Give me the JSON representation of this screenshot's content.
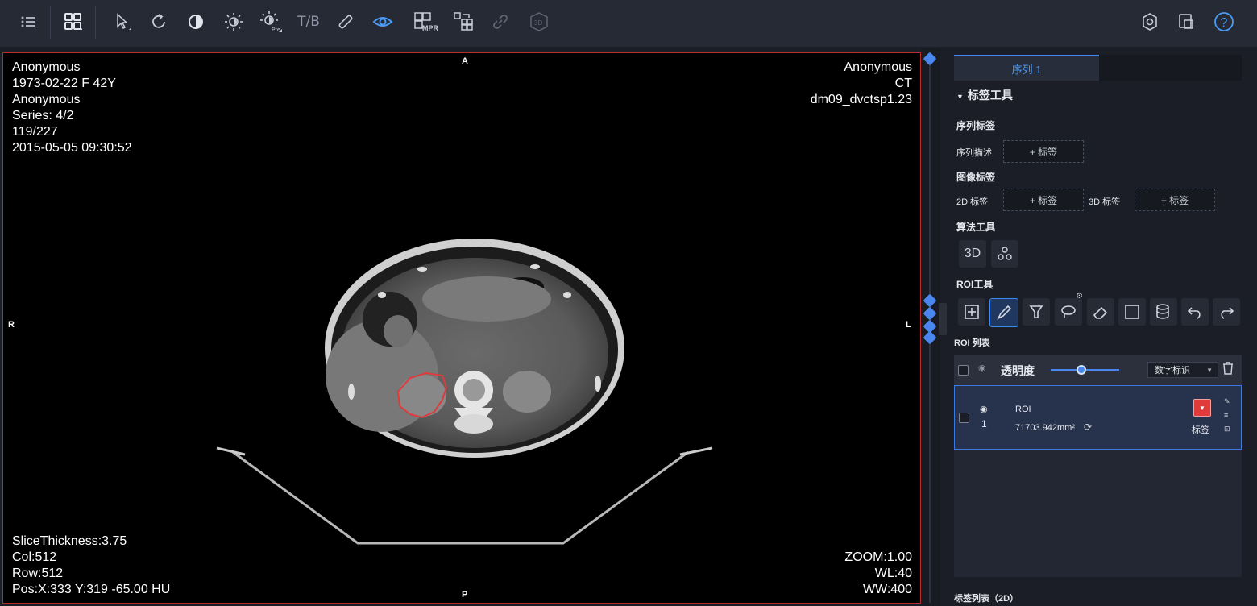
{
  "toolbar": {
    "icons": [
      "list-icon",
      "layout-grid-icon",
      "pointer-icon",
      "rotate-icon",
      "invert-icon",
      "brightness-icon",
      "brightness-preset-icon",
      "tb-toggle",
      "measure-ruler-icon",
      "eye-icon",
      "mpr-icon",
      "grid-swap-icon",
      "link-icon",
      "3d-icon",
      "settings-icon",
      "export-icon",
      "help-icon"
    ],
    "tb_label": "T/B",
    "mpr_label": "MPR",
    "badge_3d": "3D",
    "pre_label": "Pre"
  },
  "viewer": {
    "top_left": [
      "Anonymous",
      "1973-02-22 F 42Y",
      "Anonymous",
      "Series: 4/2",
      "119/227",
      "2015-05-05 09:30:52"
    ],
    "top_right": [
      "Anonymous",
      "CT",
      "dm09_dvctsp1.23"
    ],
    "bottom_left": [
      "SliceThickness:3.75",
      "Col:512",
      "Row:512",
      "Pos:X:333 Y:319 -65.00 HU"
    ],
    "bottom_right": [
      "ZOOM:1.00",
      "WL:40",
      "WW:400"
    ],
    "orient": {
      "top": "A",
      "bottom": "P",
      "left": "R",
      "right": "L"
    }
  },
  "panel": {
    "tab": "序列 1",
    "section": "标签工具",
    "series_tags_title": "序列标签",
    "series_desc_label": "序列描述",
    "add_tag": "+ 标签",
    "image_tags_title": "图像标签",
    "tag2d_label": "2D 标签",
    "tag3d_label": "3D 标签",
    "algo_title": "算法工具",
    "algo_3d": "3D",
    "roi_tools_title": "ROI工具",
    "roi_list_title": "ROI 列表",
    "opacity_label": "透明度",
    "opacity_value": 0.45,
    "select_value": "数字标识",
    "roi_name": "ROI",
    "roi_index": "1",
    "roi_area": "71703.942mm²",
    "roi_tag_label": "标签",
    "tag_list_title": "标签列表（2D）"
  },
  "colors": {
    "accent": "#3f8af2",
    "roi": "#e03a3a",
    "panel_bg": "#1b1e26"
  }
}
